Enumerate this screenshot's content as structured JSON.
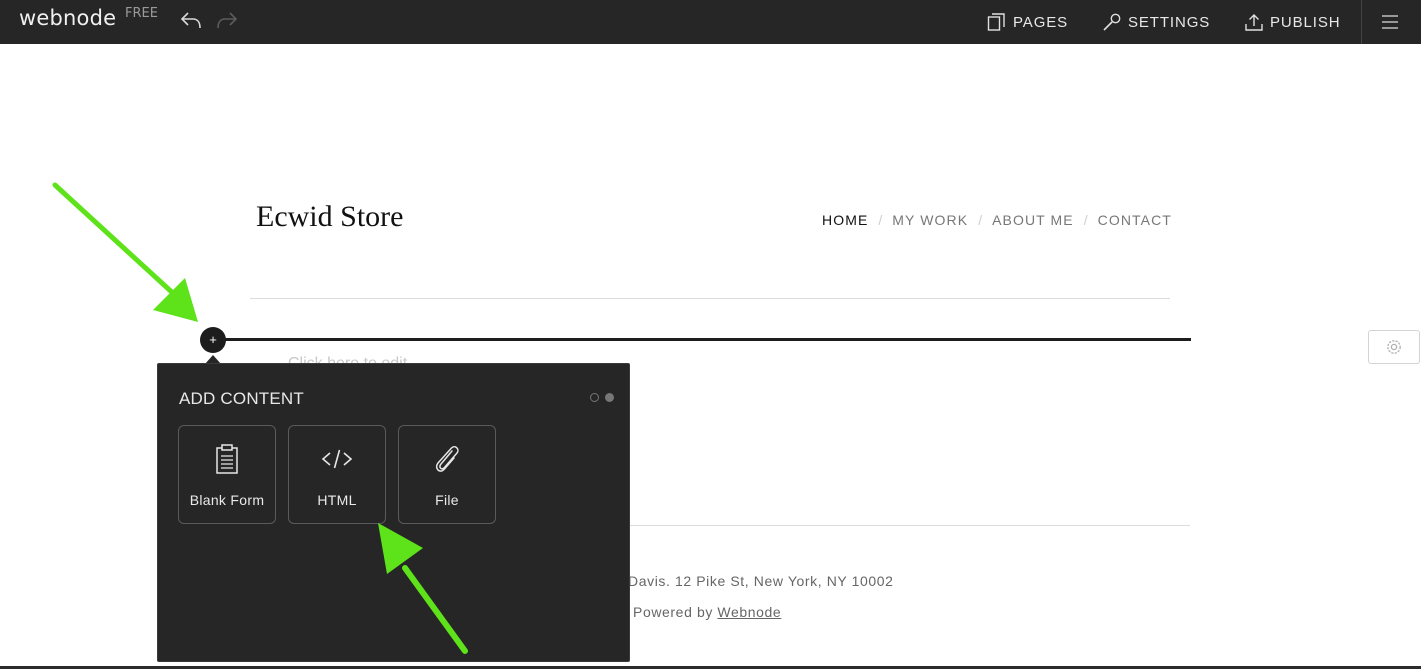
{
  "toolbar": {
    "brand": "webnode",
    "brand_tag": "FREE",
    "pages_label": "PAGES",
    "settings_label": "SETTINGS",
    "publish_label": "PUBLISH"
  },
  "site": {
    "title": "Ecwid Store",
    "nav": [
      "HOME",
      "MY WORK",
      "ABOUT ME",
      "CONTACT"
    ],
    "active_nav": "HOME",
    "placeholder": "Click here to edit...",
    "footer_address": "Davis. 12 Pike St, New York, NY 10002",
    "footer_powered_prefix": "Powered by ",
    "footer_powered_link": "Webnode"
  },
  "add_button_label": "+",
  "panel": {
    "title": "ADD CONTENT",
    "tiles": [
      {
        "label": "Blank Form",
        "icon": "form-icon"
      },
      {
        "label": "HTML",
        "icon": "code-icon"
      },
      {
        "label": "File",
        "icon": "paperclip-icon"
      }
    ],
    "pager_active_page": 2,
    "pager_total_pages": 2
  },
  "colors": {
    "toolbar_bg": "#262626",
    "panel_bg": "#262626",
    "annotation_arrow": "#5ee31b"
  }
}
